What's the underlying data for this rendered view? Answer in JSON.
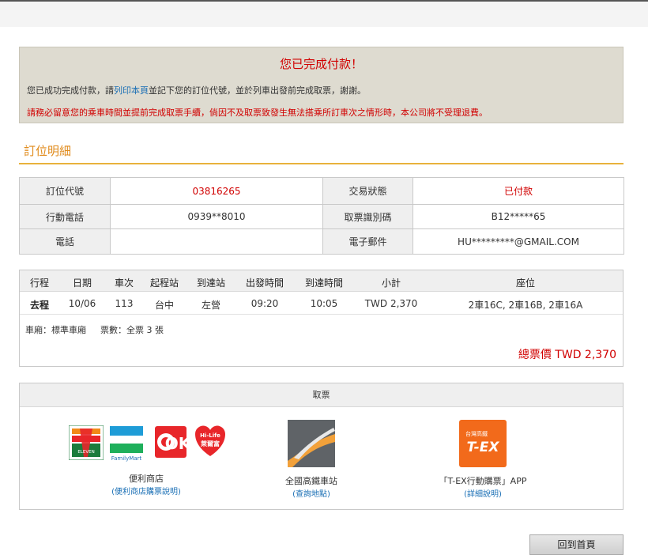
{
  "notice": {
    "title": "您已完成付款！",
    "line_before": "您已成功完成付款，請",
    "print_link": "列印本頁",
    "line_after": "並記下您的訂位代號，並於列車出發前完成取票，謝謝。",
    "warning": "請務必留意您的乘車時間並提前完成取票手續，倘因不及取票致發生無法搭乘所訂車次之情形時，本公司將不受理退費。"
  },
  "section_title": "訂位明細",
  "booking": {
    "pnr_label": "訂位代號",
    "pnr": "03816265",
    "status_label": "交易狀態",
    "status": "已付款",
    "phone_label": "行動電話",
    "phone": "0939**8010",
    "ticket_id_label": "取票識別碼",
    "ticket_id": "B12*****65",
    "tel_label": "電話",
    "tel": "",
    "email_label": "電子郵件",
    "email": "HU*********@GMAIL.COM"
  },
  "trip": {
    "headers": [
      "行程",
      "日期",
      "車次",
      "起程站",
      "到達站",
      "出發時間",
      "到達時間",
      "小計",
      "座位"
    ],
    "row": [
      "去程",
      "10/06",
      "113",
      "台中",
      "左營",
      "09:20",
      "10:05",
      "TWD 2,370",
      "2車16C, 2車16B, 2車16A"
    ],
    "car_type": "車廂：標準車廂",
    "ticket_count": "票數：全票 3 張",
    "total": "總票價  TWD 2,370"
  },
  "pickup": {
    "title": "取票",
    "stores_label": "便利商店",
    "stores_link": "(便利商店購票說明)",
    "stations_label": "全國高鐵車站",
    "stations_link": "(查詢地點)",
    "app_label": "「T-EX行動購票」APP",
    "app_link": "(詳細說明)",
    "logos": {
      "seven": "ELEVEN",
      "familymart": "FamilyMart",
      "ok": "OK",
      "hilife_top": "Hi-Life",
      "hilife_bottom": "萊爾富",
      "tex_top": "台灣高鐵",
      "tex_main": "T-EX"
    }
  },
  "home_button": "回到首頁",
  "colors": {
    "accent_red": "#d10000",
    "section_orange": "#e08a1a",
    "link_blue": "#1a6fb5"
  }
}
